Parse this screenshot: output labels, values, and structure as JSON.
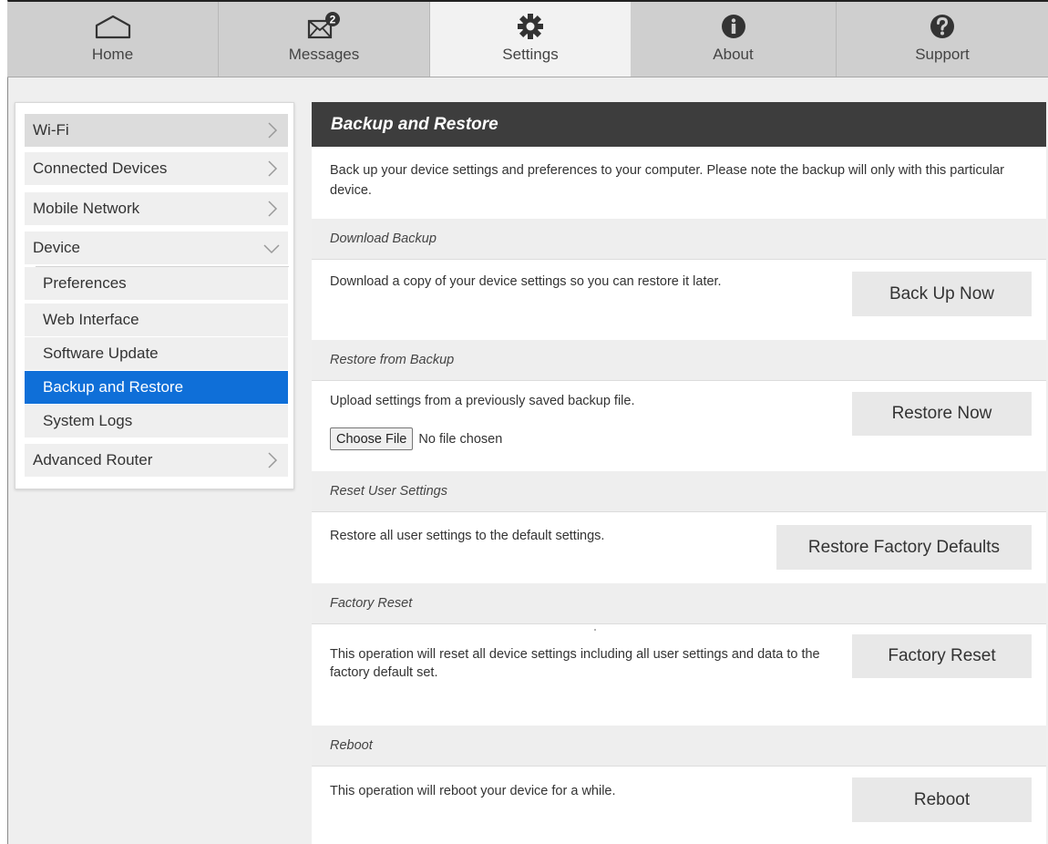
{
  "nav": {
    "tabs": [
      {
        "label": "Home",
        "icon": "home-icon"
      },
      {
        "label": "Messages",
        "icon": "mail-icon",
        "badge": "2"
      },
      {
        "label": "Settings",
        "icon": "gear-icon"
      },
      {
        "label": "About",
        "icon": "info-icon"
      },
      {
        "label": "Support",
        "icon": "help-icon"
      }
    ],
    "active_tab": "Settings"
  },
  "sidebar": {
    "items": [
      {
        "label": "Wi-Fi"
      },
      {
        "label": "Connected Devices"
      },
      {
        "label": "Mobile Network"
      },
      {
        "label": "Device"
      },
      {
        "label": "Advanced Router"
      }
    ],
    "device_sub": [
      {
        "label": "Preferences"
      },
      {
        "label": "Web Interface"
      },
      {
        "label": "Software Update"
      },
      {
        "label": "Backup and Restore"
      },
      {
        "label": "System Logs"
      }
    ],
    "selected": "Backup and Restore"
  },
  "main": {
    "title": "Backup and Restore",
    "intro": "Back up your device settings and preferences to your computer. Please note the backup will only with this particular device.",
    "sections": [
      {
        "heading": "Download Backup",
        "text": "Download a copy of your device settings so you can restore it later.",
        "button": "Back Up Now"
      },
      {
        "heading": "Restore from Backup",
        "text": "Upload settings from a previously saved backup file.",
        "button": "Restore Now",
        "file_button": "Choose File",
        "file_status": "No file chosen"
      },
      {
        "heading": "Reset User Settings",
        "text": "Restore all user settings to the default settings.",
        "button": "Restore Factory Defaults"
      },
      {
        "heading": "Factory Reset",
        "text": "This operation will reset all device settings including all user settings and data to the factory default set.",
        "button": "Factory Reset"
      },
      {
        "heading": "Reboot",
        "text": "This operation will reboot your device for a while.",
        "button": "Reboot"
      }
    ]
  },
  "colors": {
    "header_bg": "#3d3d3d",
    "selected_bg": "#0f6fd8",
    "nav_bg": "#cfcfcf",
    "active_tab_bg": "#f2f2f2"
  }
}
